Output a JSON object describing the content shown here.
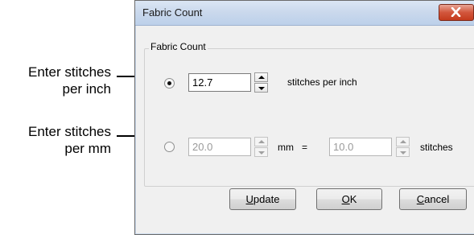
{
  "callouts": {
    "per_inch": {
      "line1": "Enter stitches",
      "line2": "per inch"
    },
    "per_mm": {
      "line1": "Enter stitches",
      "line2": "per mm"
    }
  },
  "dialog": {
    "title": "Fabric Count",
    "group_label": "Fabric Count",
    "inch_row": {
      "value": "12.7",
      "unit_label": "stitches per inch",
      "selected": true
    },
    "mm_row": {
      "mm_value": "20.0",
      "mm_label": "mm",
      "equals": "=",
      "stitch_value": "10.0",
      "stitch_label": "stitches",
      "selected": false
    },
    "buttons": {
      "update": {
        "mnemonic": "U",
        "rest": "pdate"
      },
      "ok": {
        "mnemonic": "O",
        "rest": "K"
      },
      "cancel": {
        "mnemonic": "C",
        "rest": "ancel"
      }
    }
  },
  "icons": {
    "close": "close-icon",
    "spin_up": "spin-up-icon",
    "spin_down": "spin-down-icon"
  },
  "colors": {
    "titlebar": "#c9d8ec",
    "close_button": "#d2563c",
    "dialog_bg": "#f0f0f0"
  }
}
